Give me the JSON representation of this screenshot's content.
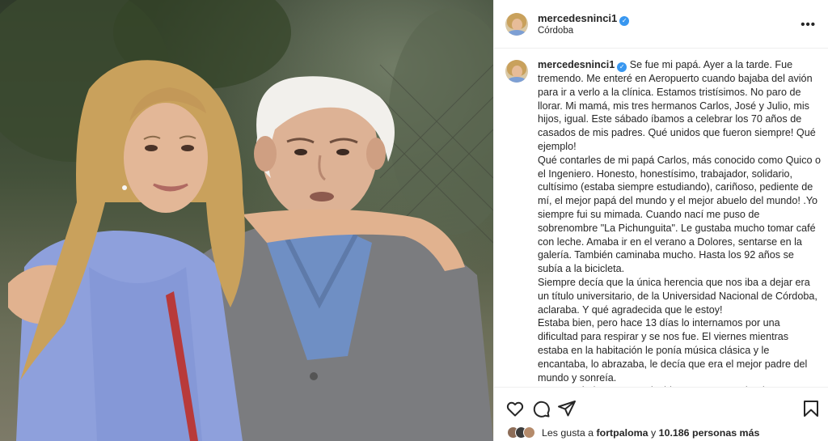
{
  "post": {
    "username": "mercedesninci1",
    "location": "Córdoba",
    "more_icon": "ellipsis-icon",
    "verified_icon": "verified-badge-icon"
  },
  "caption": {
    "username": "mercedesninci1",
    "text": "Se fue mi papá. Ayer a la tarde. Fue tremendo. Me enteré en Aeropuerto cuando bajaba del avión para ir a verlo a la clínica. Estamos tristísimos. No paro de llorar. Mi mamá, mis tres hermanos Carlos, José y Julio, mis hijos, igual. Este sábado íbamos a celebrar los 70 años de casados de mis padres. Qué unidos que fueron siempre! Qué ejemplo!\nQué contarles de mi papá Carlos, más conocido como Quico o el Ingeniero. Honesto, honestísimo, trabajador, solidario, cultísimo (estaba siempre estudiando), cariñoso, pediente de mí, el mejor papá del mundo y el mejor abuelo del mundo! .Yo siempre fui su mimada. Cuando nací me puso de sobrenombre \"La Pichunguita\". Le gustaba mucho tomar café con leche. Amaba ir en el verano a Dolores, sentarse en la galería. También caminaba mucho. Hasta los 92 años se subía a la bicicleta.\nSiempre decía que la única herencia que nos iba a dejar era un título universitario, de la Universidad Nacional de Córdoba, aclaraba. Y qué agradecida que le estoy!\nEstaba bien, pero hace 13 días lo internamos por una dificultad para respirar y se nos fue. El viernes mientras estaba en la habitación le ponía música clásica y le encantaba, lo abrazaba, le decía que era el mejor padre del mundo y sonreía.\nLes estaré siempre agradecida a nuestra empleada Marta Vanegas y a las dos enfermeras que compartieron en casa todo este tiempo Ana Laura Melgar y Elda Luján."
  },
  "actions": {
    "like_icon": "heart-icon",
    "comment_icon": "comment-icon",
    "share_icon": "paper-plane-icon",
    "save_icon": "bookmark-icon"
  },
  "likes": {
    "prefix": "Les gusta a",
    "first_user": "fortpaloma",
    "connector": "y",
    "others": "10.186 personas más"
  },
  "colors": {
    "verified": "#3897f0",
    "text": "#262626",
    "border": "#efefef"
  }
}
